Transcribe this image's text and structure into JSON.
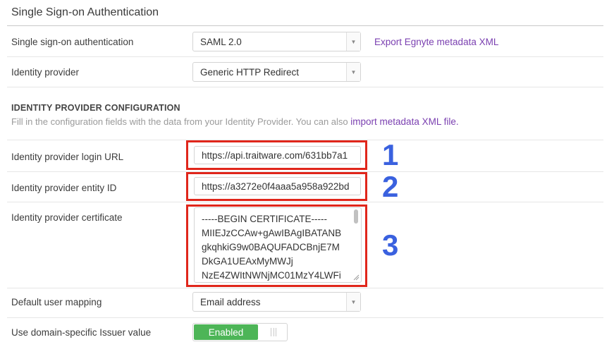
{
  "section": {
    "title": "Single Sign-on Authentication"
  },
  "sso": {
    "label": "Single sign-on authentication",
    "value": "SAML 2.0",
    "export_link": "Export Egnyte metadata XML"
  },
  "idp": {
    "label": "Identity provider",
    "value": "Generic HTTP Redirect"
  },
  "config": {
    "heading": "IDENTITY PROVIDER CONFIGURATION",
    "description": "Fill in the configuration fields with the data from your Identity Provider. You can also ",
    "import_link": "import metadata XML file."
  },
  "login_url": {
    "label": "Identity provider login URL",
    "value": "https://api.traitware.com/631bb7a1"
  },
  "entity_id": {
    "label": "Identity provider entity ID",
    "value": "https://a3272e0f4aaa5a958a922bd"
  },
  "certificate": {
    "label": "Identity provider certificate",
    "lines": [
      "-----BEGIN CERTIFICATE-----",
      "MIIEJzCCAw+gAwIBAgIBATANB",
      "gkqhkiG9w0BAQUFADCBnjE7M",
      "DkGA1UEAxMyMWJj",
      "NzE4ZWItNWNjMC01MzY4LWFi"
    ]
  },
  "user_mapping": {
    "label": "Default user mapping",
    "value": "Email address"
  },
  "issuer": {
    "label": "Use domain-specific Issuer value",
    "toggle_label": "Enabled",
    "enabled": true
  },
  "callouts": [
    "1",
    "2",
    "3"
  ],
  "colors": {
    "accent_link": "#7a3fb0",
    "highlight": "#e0261b",
    "callout": "#3a61df",
    "toggle_on": "#4db557"
  }
}
